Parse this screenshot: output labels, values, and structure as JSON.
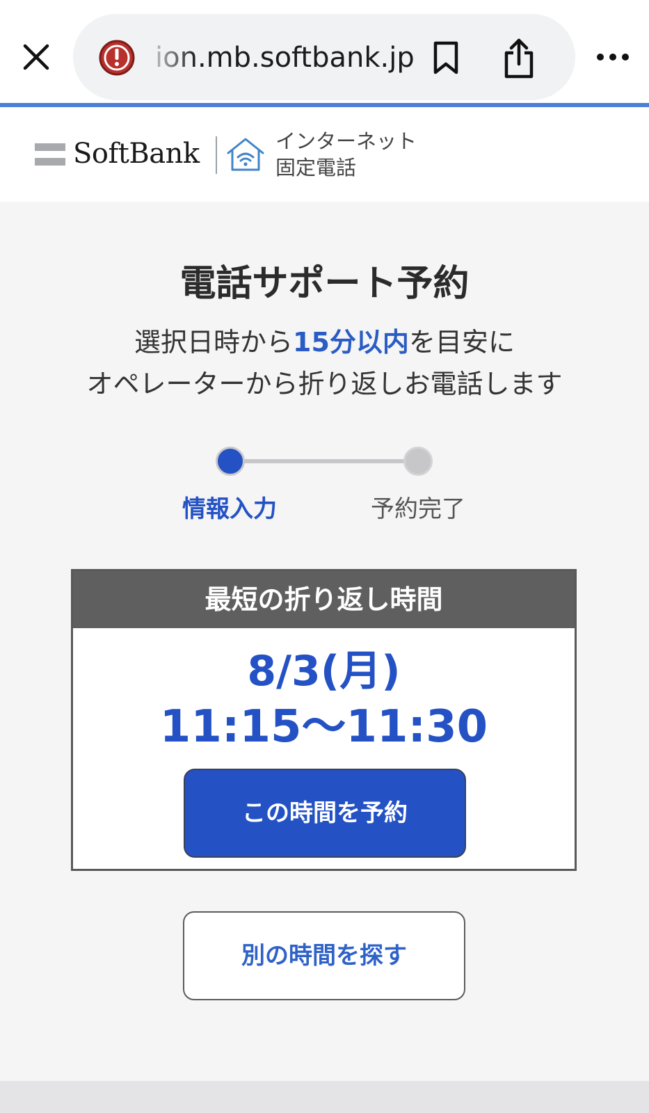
{
  "browser": {
    "url": "ion.mb.softbank.jp",
    "icons": {
      "close": "close-icon",
      "security": "warning-icon",
      "bookmark": "bookmark-icon",
      "share": "share-icon",
      "more": "more-icon"
    },
    "accent_color": "#4a7fd6"
  },
  "header": {
    "brand": "SoftBank",
    "service_line1": "インターネット",
    "service_line2": "固定電話"
  },
  "main": {
    "title": "電話サポート予約",
    "subtitle_pre": "選択日時から",
    "subtitle_highlight": "15分以内",
    "subtitle_post": "を目安に",
    "subtitle_line2": "オペレーターから折り返しお電話します",
    "steps": [
      {
        "label": "情報入力",
        "active": true
      },
      {
        "label": "予約完了",
        "active": false
      }
    ],
    "card": {
      "header": "最短の折り返し時間",
      "date": "8/3(月)",
      "time": "11:15〜11:30",
      "reserve_label": "この時間を予約"
    },
    "other_time_label": "別の時間を探す"
  },
  "colors": {
    "primary": "#2452c5",
    "card_header": "#5f5f5f"
  }
}
